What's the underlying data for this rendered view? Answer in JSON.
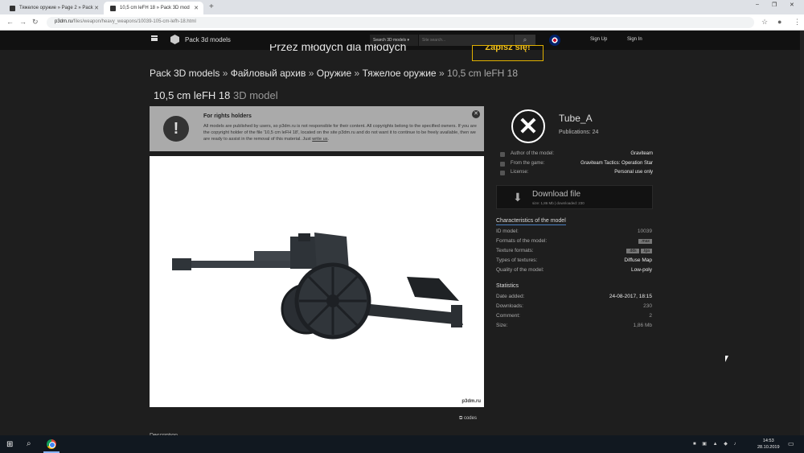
{
  "browser": {
    "tabs": [
      {
        "label": "Тяжелое оружие » Page 2 » Pack",
        "active": false
      },
      {
        "label": "10,5 cm leFH 18 » Pack 3D mod",
        "active": true
      }
    ],
    "new_tab": "+",
    "window_controls": {
      "minimize": "–",
      "maximize": "❐",
      "close": "✕"
    },
    "url_host": "p3dm.ru",
    "url_path": "/files/weapon/heavy_weapons/10039-105-cm-lefh-18.html"
  },
  "site": {
    "logo": "Pack 3d models",
    "search_select": "Search 3D models ▾",
    "search_placeholder": "Site search...",
    "signup": "Sign Up",
    "signin": "Sign In"
  },
  "banner": {
    "text": "Przez młodych dla młodych",
    "button": "Zapisz się!"
  },
  "breadcrumb": [
    {
      "label": "Pack 3D models"
    },
    {
      "label": "Файловый архив"
    },
    {
      "label": "Оружие"
    },
    {
      "label": "Тяжелое оружие"
    },
    {
      "label": "10,5 cm leFH 18"
    }
  ],
  "breadcrumb_sep": "»",
  "title": {
    "main": "10,5 cm leFH 18",
    "sub": "3D model"
  },
  "rights": {
    "title": "For rights holders",
    "body_before_link": "All models are published by users, so p3dm.ru is not responsible for their content. All copyrights belong to the specified owners. If you are the copyright holder of the file '10,5 cm leFH 18', located on the site p3dm.ru and do not want it to continue to be freely available, then we are ready to assist in the removal of this material. Just ",
    "link": "write us",
    "body_after_link": ".",
    "close": "✕"
  },
  "preview": {
    "watermark": "p3dm.ru"
  },
  "codes": "codes",
  "description_cut": "Description",
  "author": {
    "name": "Tube_A",
    "publications": "Publications: 24"
  },
  "meta": [
    {
      "label": "Author of the model:",
      "value": "Graviteam"
    },
    {
      "label": "From the game:",
      "value": "Graviteam Tactics: Operation Star"
    },
    {
      "label": "License:",
      "value": "Personal use only"
    }
  ],
  "download": {
    "label": "Download file",
    "sub": "size: 1,86 Mb | downloaded: 230"
  },
  "characteristics": {
    "heading": "Characteristics of the model",
    "rows": [
      {
        "label": "ID model:",
        "value": "10039"
      },
      {
        "label": "Formats of the model:",
        "chips": [
          ".max"
        ]
      },
      {
        "label": "Texture formats:",
        "chips": [
          ".dds",
          ".tga"
        ]
      },
      {
        "label": "Types of textures:",
        "value": "Diffuse Map"
      },
      {
        "label": "Quality of the model:",
        "value": "Low-poly"
      }
    ]
  },
  "statistics": {
    "heading": "Statistics",
    "rows": [
      {
        "label": "Date added:",
        "value": "24-08-2017, 18:15"
      },
      {
        "label": "Downloads:",
        "value": "230"
      },
      {
        "label": "Comment:",
        "value": "2"
      },
      {
        "label": "Size:",
        "value": "1,86 Mb"
      }
    ]
  },
  "taskbar": {
    "time": "14:53",
    "date": "28.10.2019"
  }
}
